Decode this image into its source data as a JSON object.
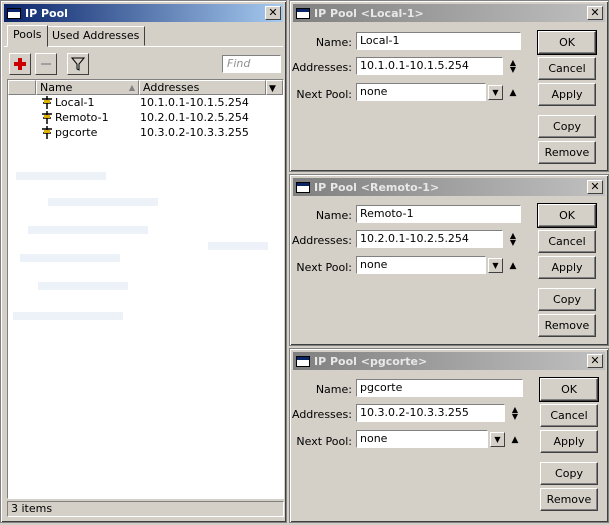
{
  "pool_list": {
    "title": "IP Pool",
    "tabs": [
      "Pools",
      "Used Addresses"
    ],
    "find_placeholder": "Find",
    "columns": [
      "Name",
      "Addresses"
    ],
    "rows": [
      {
        "name": "Local-1",
        "addresses": "10.1.0.1-10.1.5.254"
      },
      {
        "name": "Remoto-1",
        "addresses": "10.2.0.1-10.2.5.254"
      },
      {
        "name": "pgcorte",
        "addresses": "10.3.0.2-10.3.3.255"
      }
    ],
    "status": "3 items"
  },
  "dialogs": [
    {
      "title": "IP Pool <Local-1>",
      "name_label": "Name:",
      "name_value": "Local-1",
      "addresses_label": "Addresses:",
      "addresses_value": "10.1.0.1-10.1.5.254",
      "nextpool_label": "Next Pool:",
      "nextpool_value": "none",
      "buttons": {
        "ok": "OK",
        "cancel": "Cancel",
        "apply": "Apply",
        "copy": "Copy",
        "remove": "Remove"
      }
    },
    {
      "title": "IP Pool <Remoto-1>",
      "name_label": "Name:",
      "name_value": "Remoto-1",
      "addresses_label": "Addresses:",
      "addresses_value": "10.2.0.1-10.2.5.254",
      "nextpool_label": "Next Pool:",
      "nextpool_value": "none",
      "buttons": {
        "ok": "OK",
        "cancel": "Cancel",
        "apply": "Apply",
        "copy": "Copy",
        "remove": "Remove"
      }
    },
    {
      "title": "IP Pool <pgcorte>",
      "name_label": "Name:",
      "name_value": "pgcorte",
      "addresses_label": "Addresses:",
      "addresses_value": "10.3.0.2-10.3.3.255",
      "nextpool_label": "Next Pool:",
      "nextpool_value": "none",
      "buttons": {
        "ok": "OK",
        "cancel": "Cancel",
        "apply": "Apply",
        "copy": "Copy",
        "remove": "Remove"
      }
    }
  ],
  "colors": {
    "accent_add": "#cc0000",
    "title_active": "#0a246a",
    "title_inactive": "#808080"
  }
}
